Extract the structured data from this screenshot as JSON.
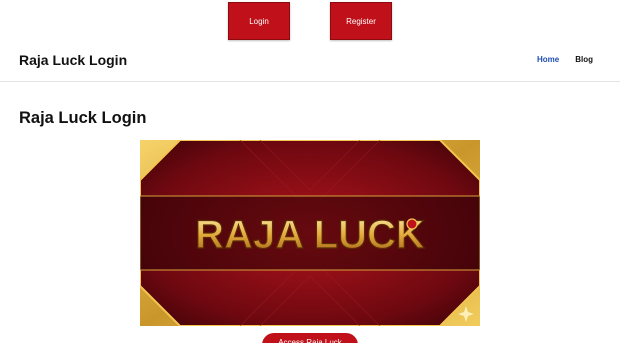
{
  "top_actions": {
    "login_label": "Login",
    "register_label": "Register"
  },
  "header": {
    "site_title": "Raja Luck Login",
    "nav": [
      {
        "label": "Home"
      },
      {
        "label": "Blog"
      }
    ]
  },
  "main": {
    "page_title": "Raja Luck Login",
    "banner": {
      "logo_text": "RAJA LUCK"
    },
    "cta_label": "Access Raja Luck"
  },
  "colors": {
    "accent_red": "#c0111a",
    "nav_active": "#1f4fb0",
    "banner_gold": "#e2b43a",
    "banner_red": "#8a0b14"
  }
}
